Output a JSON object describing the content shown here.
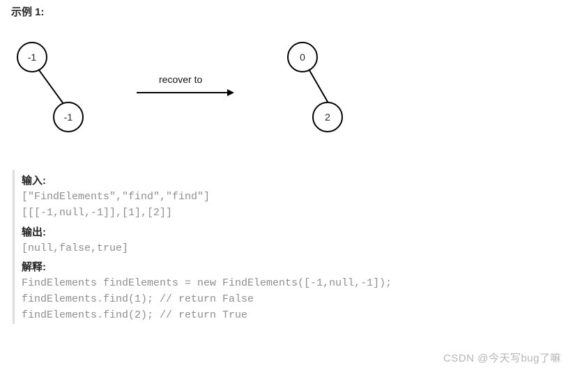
{
  "title": "示例 1:",
  "diagram": {
    "arrow_label": "recover to",
    "left_tree": {
      "root": "-1",
      "right_child": "-1"
    },
    "right_tree": {
      "root": "0",
      "right_child": "2"
    }
  },
  "io": {
    "input_label": "输入:",
    "input_line1": "[\"FindElements\",\"find\",\"find\"]",
    "input_line2": "[[[-1,null,-1]],[1],[2]]",
    "output_label": "输出:",
    "output_line": "[null,false,true]",
    "explain_label": "解释:",
    "explain_line1": "FindElements findElements = new FindElements([-1,null,-1]);",
    "explain_line2": "findElements.find(1); // return False",
    "explain_line3": "findElements.find(2); // return True"
  },
  "watermark": "CSDN @今天写bug了嘛"
}
